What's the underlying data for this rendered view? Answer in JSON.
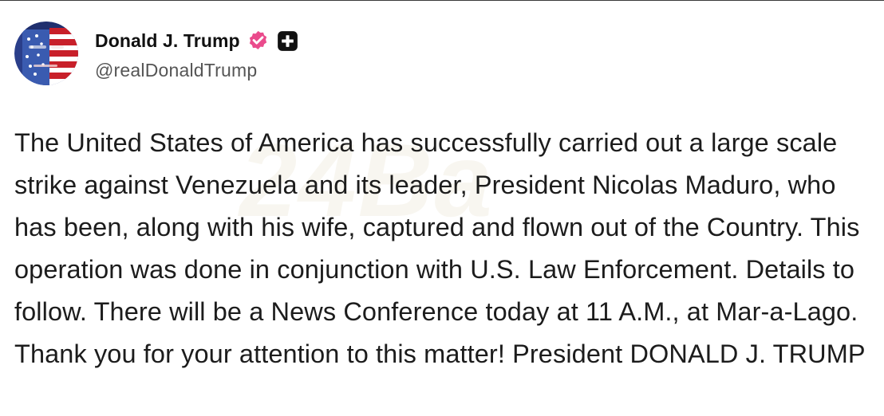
{
  "post": {
    "author": {
      "display_name": "Donald J. Trump",
      "handle": "@realDonaldTrump",
      "verified_icon": "verified-badge-icon",
      "extra_badge_icon": "plus-badge-icon"
    },
    "watermark_text": "24Ba",
    "text": "The United States of America has successfully carried out a large scale strike against Venezuela and its leader, President Nicolas Maduro, who has been, along with his wife, captured and flown out of the Country. This operation was done in conjunction with U.S. Law Enforcement. Details to follow. There will be a News Conference today at 11 A.M., at Mar-a-Lago. Thank you for your attention to this matter! President DONALD J. TRUMP"
  },
  "colors": {
    "verified_badge": "#ea4b8c",
    "plus_badge": "#111111",
    "text": "#1c1c1c",
    "handle": "#555555"
  }
}
